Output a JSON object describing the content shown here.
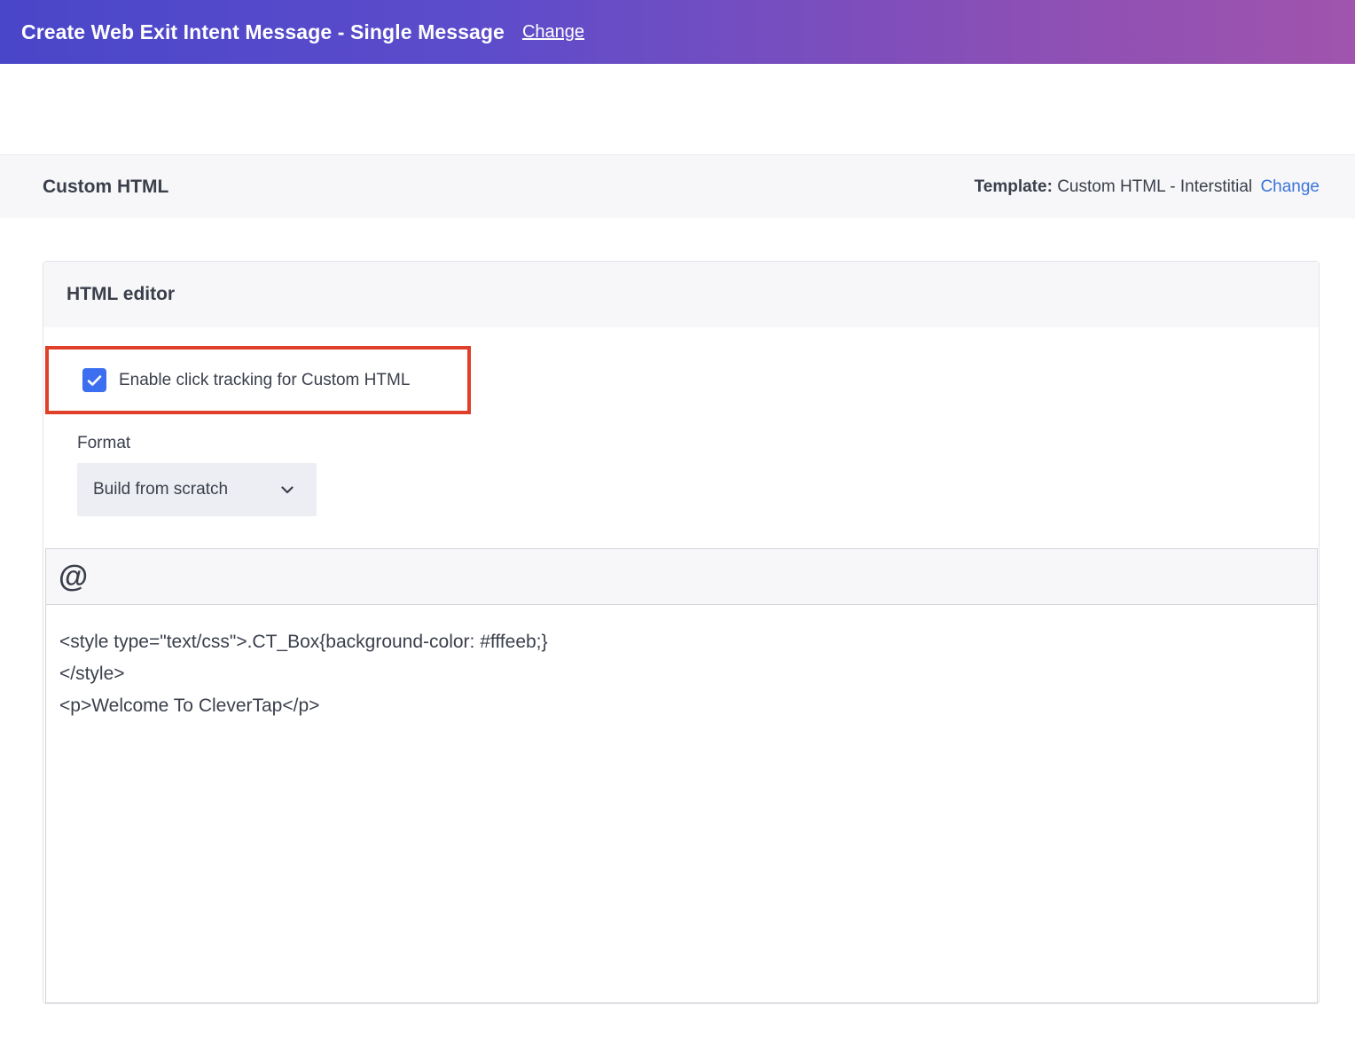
{
  "topbar": {
    "title": "Create Web Exit Intent Message - Single Message",
    "change_label": "Change"
  },
  "section": {
    "title": "Custom HTML",
    "template_label": "Template:",
    "template_value": "Custom HTML - Interstitial",
    "template_change_label": "Change"
  },
  "editor_card": {
    "title": "HTML editor",
    "click_tracking": {
      "label": "Enable click tracking for Custom HTML",
      "checked": true
    },
    "format": {
      "label": "Format",
      "selected": "Build from scratch"
    },
    "toolbar": {
      "at_icon": "@"
    },
    "code_lines": [
      "<style type=\"text/css\">.CT_Box{background-color: #fffeeb;}",
      "</style>",
      "<p>Welcome To CleverTap</p>"
    ]
  },
  "colors": {
    "accent_blue": "#3b74d9",
    "checkbox_blue": "#3b6ff0",
    "highlight_red": "#e0402a",
    "gradient_start": "#4a46c9",
    "gradient_end": "#a054ad"
  }
}
